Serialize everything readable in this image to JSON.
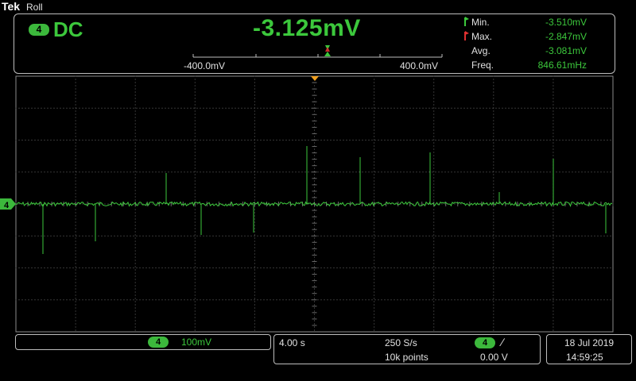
{
  "brand": "Tek",
  "mode": "Roll",
  "meter": {
    "channel": "4",
    "coupling": "DC",
    "reading": "-3.125mV",
    "scale_left": "-400.0mV",
    "scale_right": "400.0mV",
    "stats": [
      {
        "label": "Min.",
        "value": "-3.510mV"
      },
      {
        "label": "Max.",
        "value": "-2.847mV"
      },
      {
        "label": "Avg.",
        "value": "-3.081mV"
      },
      {
        "label": "Freq.",
        "value": "846.61mHz"
      }
    ]
  },
  "graticule": {
    "channel_marker": "4",
    "trace_color": "#3cc83c",
    "grid_color": "#6a6a6a"
  },
  "status": {
    "channel": "4",
    "volts_per_div": "100mV",
    "time_per_div": "4.00 s",
    "sample_rate": "250 S/s",
    "record_length": "10k points",
    "trigger_channel": "4",
    "trigger_slope": "∕",
    "trigger_level": "0.00 V",
    "date": "18 Jul  2019",
    "time": "14:59:25"
  }
}
